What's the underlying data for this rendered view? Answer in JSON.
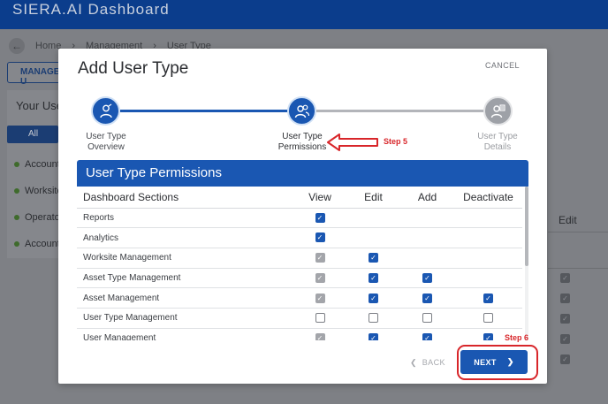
{
  "app": {
    "brand": "SIERA.AI Dashboard"
  },
  "breadcrumb": {
    "home": "Home",
    "management": "Management",
    "user_type": "User Type",
    "back_icon": "arrow-left-icon"
  },
  "background": {
    "manage_button": "MANAGE U",
    "panel_title": "Your Use",
    "all_tab": "All",
    "list_items": [
      "Account",
      "Worksite",
      "Operator",
      "Account"
    ],
    "right_column_header": "Edit"
  },
  "modal": {
    "title": "Add User Type",
    "cancel_label": "CANCEL",
    "steps": [
      {
        "label_line1": "User Type",
        "label_line2": "Overview",
        "state": "done",
        "icon": "user-icon"
      },
      {
        "label_line1": "User Type",
        "label_line2": "Permissions",
        "state": "active",
        "icon": "users-icon"
      },
      {
        "label_line1": "User Type",
        "label_line2": "Details",
        "state": "todo",
        "icon": "user-details-icon"
      }
    ],
    "annotations": {
      "step5": "Step 5",
      "step6": "Step 6"
    },
    "permissions_title": "User Type Permissions",
    "table": {
      "headers": [
        "Dashboard Sections",
        "View",
        "Edit",
        "Add",
        "Deactivate"
      ],
      "rows": [
        {
          "section": "Reports",
          "view": "on",
          "edit": "",
          "add": "",
          "deactivate": ""
        },
        {
          "section": "Analytics",
          "view": "on",
          "edit": "",
          "add": "",
          "deactivate": ""
        },
        {
          "section": "Worksite Management",
          "view": "dis",
          "edit": "on",
          "add": "",
          "deactivate": ""
        },
        {
          "section": "Asset Type Management",
          "view": "dis",
          "edit": "on",
          "add": "on",
          "deactivate": ""
        },
        {
          "section": "Asset Management",
          "view": "dis",
          "edit": "on",
          "add": "on",
          "deactivate": "on"
        },
        {
          "section": "User Type Management",
          "view": "off",
          "edit": "off",
          "add": "off",
          "deactivate": "off"
        },
        {
          "section": "User Management",
          "view": "dis",
          "edit": "on",
          "add": "on",
          "deactivate": "on"
        }
      ]
    },
    "back_label": "BACK",
    "next_label": "NEXT",
    "colors": {
      "primary": "#1a57b2",
      "annotation": "#d8262a"
    }
  }
}
